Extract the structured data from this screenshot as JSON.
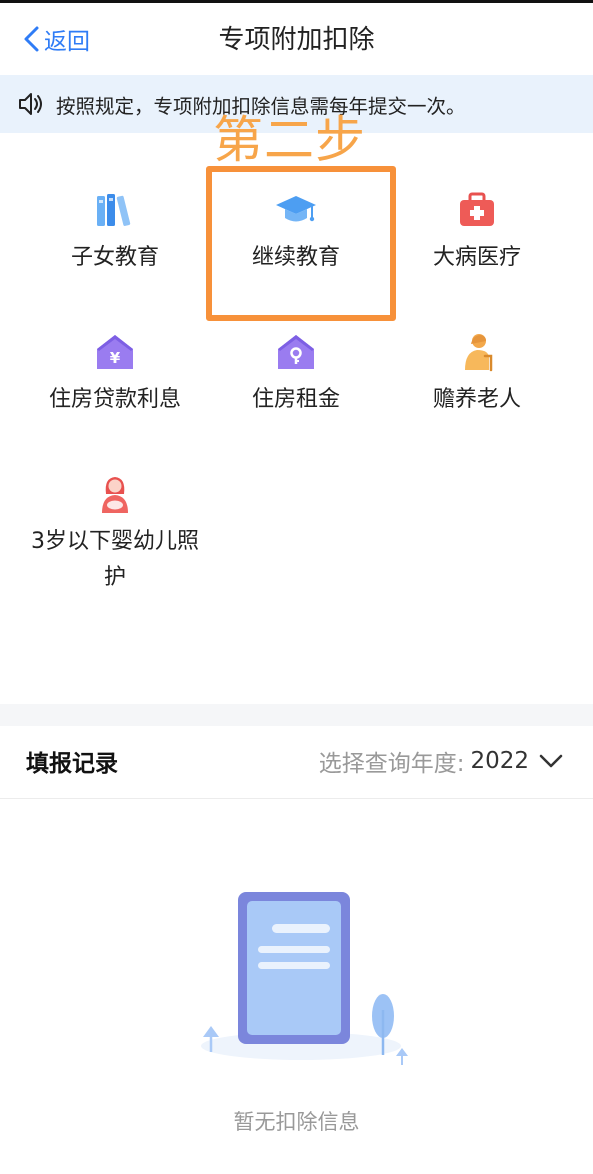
{
  "header": {
    "back_label": "返回",
    "title": "专项附加扣除"
  },
  "notice": {
    "text": "按照规定，专项附加扣除信息需每年提交一次。"
  },
  "annotation": {
    "step_label": "第二步"
  },
  "categories": [
    {
      "label": "子女教育",
      "icon": "books-icon"
    },
    {
      "label": "继续教育",
      "icon": "graduation-cap-icon"
    },
    {
      "label": "大病医疗",
      "icon": "medical-kit-icon"
    },
    {
      "label": "住房贷款利息",
      "icon": "house-yuan-icon"
    },
    {
      "label": "住房租金",
      "icon": "house-key-icon"
    },
    {
      "label": "赡养老人",
      "icon": "elderly-icon"
    },
    {
      "label": "3岁以下婴幼儿照护",
      "icon": "mother-baby-icon"
    }
  ],
  "records": {
    "title": "填报记录",
    "year_prompt": "选择查询年度:",
    "year_value": "2022"
  },
  "empty_state": {
    "text": "暂无扣除信息"
  },
  "colors": {
    "accent": "#2f7cf6",
    "notice_bg": "#e9f2fc",
    "annotation": "#f7913a",
    "muted_text": "#999999"
  }
}
